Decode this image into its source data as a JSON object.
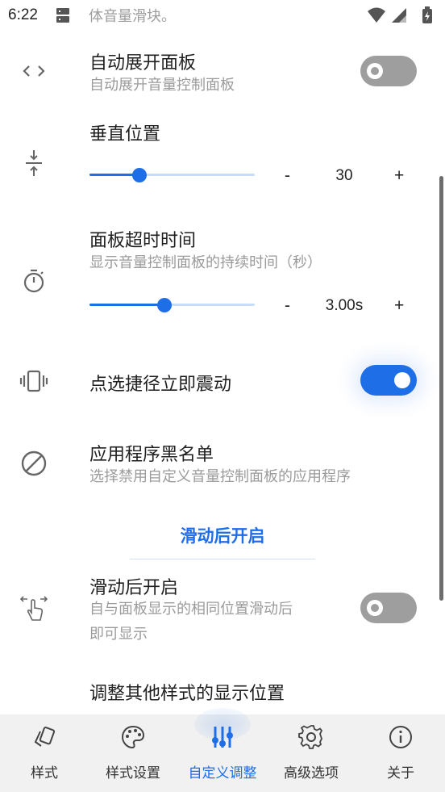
{
  "status_bar": {
    "time": "6:22",
    "cut_text": "体音量滑块。"
  },
  "settings": {
    "auto_expand": {
      "title": "自动展开面板",
      "subtitle": "自动展开音量控制面板",
      "enabled": false
    },
    "vertical_position": {
      "title": "垂直位置",
      "minus_label": "-",
      "plus_label": "+",
      "value_text": "30",
      "slider_fraction": 0.3
    },
    "panel_timeout": {
      "title": "面板超时时间",
      "subtitle": "显示音量控制面板的持续时间（秒）",
      "minus_label": "-",
      "plus_label": "+",
      "value_text": "3.00s",
      "slider_fraction": 0.455
    },
    "vibrate_on_shortcut": {
      "title": "点选捷径立即震动",
      "enabled": true
    },
    "app_blacklist": {
      "title": "应用程序黑名单",
      "subtitle": "选择禁用自定义音量控制面板的应用程序"
    }
  },
  "section_swipe": {
    "header": "滑动后开启",
    "enable_after_swipe": {
      "title": "滑动后开启",
      "subtitle_line1": "自与面板显示的相同位置滑动后",
      "subtitle_line2": "即可显示",
      "enabled": false
    },
    "adjust_position": {
      "title": "调整其他样式的显示位置"
    }
  },
  "bottom_nav": {
    "items": [
      {
        "label": "样式",
        "icon": "cards-icon"
      },
      {
        "label": "样式设置",
        "icon": "palette-icon"
      },
      {
        "label": "自定义调整",
        "icon": "tune-sliders-icon",
        "active": true
      },
      {
        "label": "高级选项",
        "icon": "gear-icon"
      },
      {
        "label": "关于",
        "icon": "info-icon"
      }
    ]
  },
  "colors": {
    "accent": "#1e6ee8",
    "switch_off": "#9e9e9e",
    "text_secondary": "#9b9b9b",
    "nav_bg": "#f1f1f1"
  }
}
